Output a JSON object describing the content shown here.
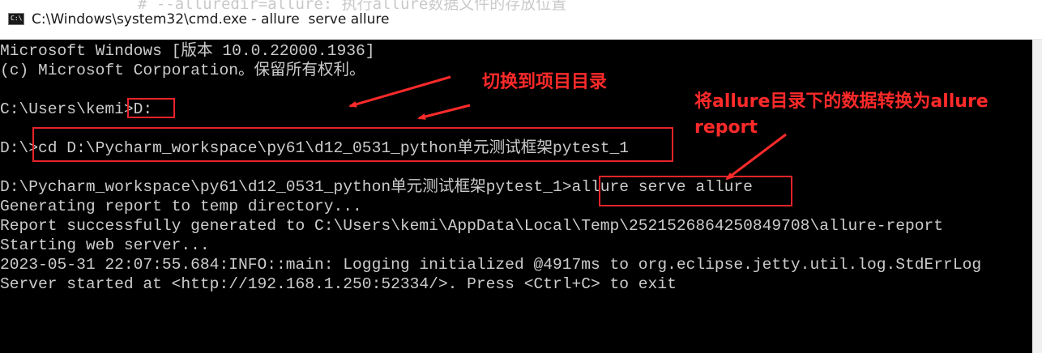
{
  "window": {
    "title": "C:\\Windows\\system32\\cmd.exe - allure  serve allure",
    "icon": "cmd-icon",
    "icon_glyph": "C:\\",
    "background_text": "# --alluredir=allure: 执行allure数据文件的存放位置"
  },
  "terminal": {
    "lines": [
      "Microsoft Windows [版本 10.0.22000.1936]",
      "(c) Microsoft Corporation。保留所有权利。",
      "",
      "C:\\Users\\kemi>D:",
      "",
      "D:\\>cd D:\\Pycharm_workspace\\py61\\d12_0531_python单元测试框架pytest_1",
      "",
      "D:\\Pycharm_workspace\\py61\\d12_0531_python单元测试框架pytest_1>allure serve allure",
      "Generating report to temp directory...",
      "Report successfully generated to C:\\Users\\kemi\\AppData\\Local\\Temp\\2521526864250849708\\allure-report",
      "Starting web server...",
      "2023-05-31 22:07:55.684:INFO::main: Logging initialized @4917ms to org.eclipse.jetty.util.log.StdErrLog",
      "Server started at <http://192.168.1.250:52334/>. Press <Ctrl+C> to exit"
    ]
  },
  "annotations": {
    "switch_dir": "切换到项目目录",
    "convert_line1": "将allure目录下的数据转换为allure",
    "convert_line2": "report"
  },
  "colors": {
    "terminal_bg": "#000000",
    "terminal_fg": "#cccccc",
    "annotation": "#ff2a2a"
  }
}
